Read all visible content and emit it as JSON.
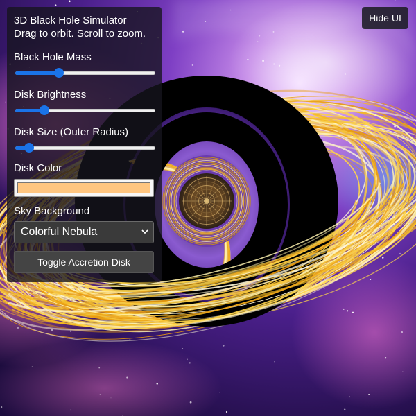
{
  "panel": {
    "title": "3D Black Hole Simulator",
    "subtitle": "Drag to orbit. Scroll to zoom.",
    "controls": {
      "mass": {
        "label": "Black Hole Mass",
        "value": 0.31
      },
      "brightness": {
        "label": "Disk Brightness",
        "value": 0.21
      },
      "disk_size": {
        "label": "Disk Size (Outer Radius)",
        "value": 0.1
      },
      "disk_color": {
        "label": "Disk Color",
        "value": "#ffc680"
      },
      "sky": {
        "label": "Sky Background",
        "selected": "Colorful Nebula"
      },
      "toggle_button": "Toggle Accretion Disk"
    }
  },
  "hide_ui_button": "Hide UI",
  "colors": {
    "slider_accent": "#1a73e8",
    "disk_gold": "#f5b921",
    "nebula_purple": "#7a3fc8",
    "nebula_pink": "#c05ab8"
  }
}
